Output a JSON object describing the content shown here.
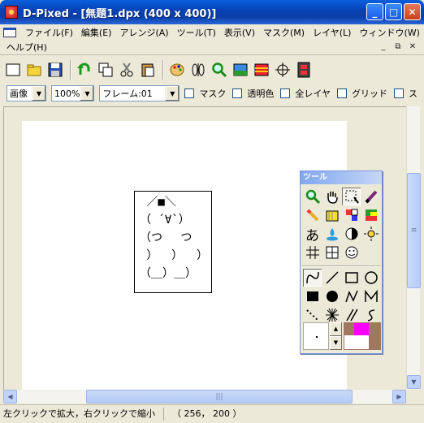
{
  "window": {
    "title": "D-Pixed - [無題1.dpx (400 x 400)]",
    "min_glyph": "_",
    "max_glyph": "□",
    "close_glyph": "✕"
  },
  "menu": {
    "items": [
      {
        "label": "ファイル(F)"
      },
      {
        "label": "編集(E)"
      },
      {
        "label": "アレンジ(A)"
      },
      {
        "label": "ツール(T)"
      },
      {
        "label": "表示(V)"
      },
      {
        "label": "マスク(M)"
      },
      {
        "label": "レイヤ(L)"
      },
      {
        "label": "ウィンドウ(W)"
      }
    ],
    "help": "ヘルプ(H)",
    "mdi_min": "_",
    "mdi_restore": "⧉",
    "mdi_close": "✕"
  },
  "toolbar": {
    "icons": [
      "new-file-icon",
      "open-folder-icon",
      "save-icon",
      "undo-icon",
      "copy-layer-icon",
      "cut-icon",
      "paste-icon",
      "palette-icon",
      "flip-icon",
      "zoom-icon",
      "image-icon",
      "layer-icon",
      "crosshair-icon",
      "film-icon"
    ]
  },
  "options": {
    "mode": "画像",
    "zoom": "100%",
    "frame": "フレーム:01",
    "checks": [
      {
        "label": "マスク"
      },
      {
        "label": "透明色"
      },
      {
        "label": "全レイヤ"
      },
      {
        "label": "グリッド"
      },
      {
        "label": "ス"
      }
    ]
  },
  "drawing": {
    "ascii_art": " ／■＼\n（ ´∀`）\n（つ　 つ\n ）  ）  ）\n（＿）＿）"
  },
  "palette": {
    "title": "ツール",
    "foreground_color": "#ff00ff",
    "background_color": "#a07860",
    "secondary_color": "#ffffff"
  },
  "status": {
    "hint": "左クリックで拡大，右クリックで縮小",
    "coords": "（ 256， 200 ）"
  }
}
